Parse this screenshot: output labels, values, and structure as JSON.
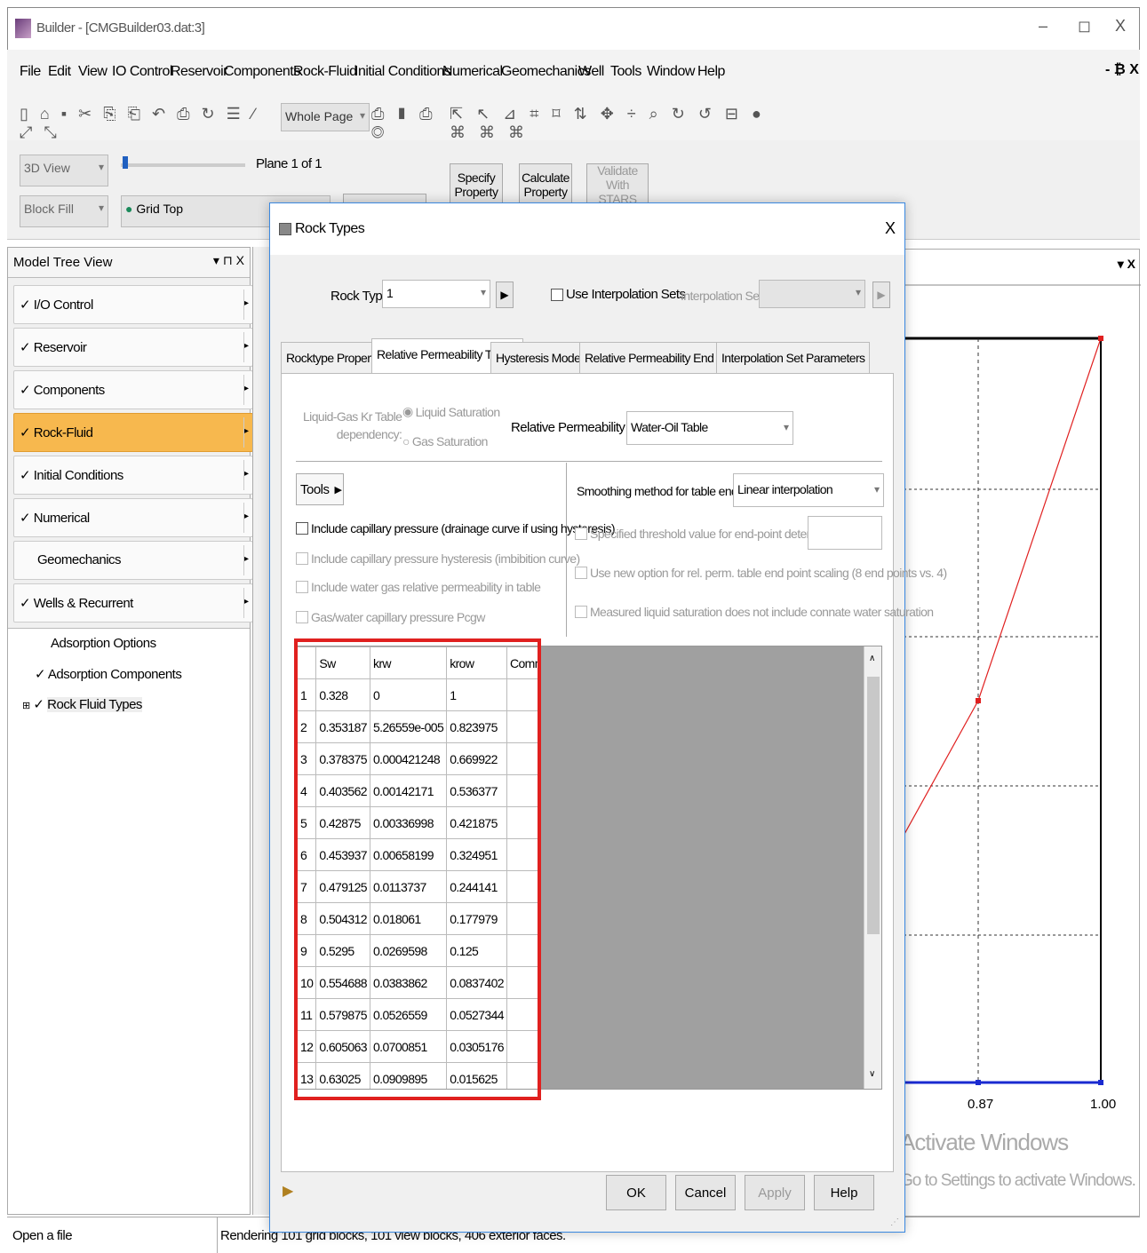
{
  "window": {
    "title": "Builder - [CMGBuilder03.dat:3]",
    "controls": {
      "minimize": "–",
      "restore": "◻",
      "close": "X"
    },
    "mdi_controls": "- ₿ X"
  },
  "menu": [
    "File",
    "Edit",
    "View",
    "IO Control",
    "Reservoir",
    "Components",
    "Rock-Fluid",
    "Initial Conditions",
    "Numerical",
    "Geomechanics",
    "Well",
    "Tools",
    "Window",
    "Help"
  ],
  "toolbar": {
    "page_combo": "Whole Page"
  },
  "ribbon": {
    "view_combo": "3D View",
    "fill_combo": "Block Fill",
    "grid_combo": "Grid Top",
    "plane_label": "Plane 1 of 1",
    "specify_property": "Specify Property",
    "calculate_property": "Calculate Property",
    "validate_stars": "Validate With STARS"
  },
  "tree": {
    "header": "Model Tree View",
    "header_icons": "▾ ⊓ X",
    "sections": [
      {
        "label": "I/O Control",
        "check": "✓"
      },
      {
        "label": "Reservoir",
        "check": "✓"
      },
      {
        "label": "Components",
        "check": "✓"
      },
      {
        "label": "Rock-Fluid",
        "check": "✓"
      },
      {
        "label": "Initial Conditions",
        "check": "✓"
      },
      {
        "label": "Numerical",
        "check": "✓"
      },
      {
        "label": "Geomechanics",
        "check": ""
      },
      {
        "label": "Wells & Recurrent",
        "check": "✓"
      }
    ],
    "items": [
      "Adsorption Options",
      "Adsorption Components",
      "Rock Fluid Types"
    ]
  },
  "plot": {
    "panel_close": "▾ X",
    "x_ticks": [
      "0.87",
      "1.00"
    ],
    "watermark_line1": "Activate Windows",
    "watermark_line2": "Go to Settings to activate Windows."
  },
  "dialog": {
    "title": "Rock Types",
    "close": "X",
    "rock_type_label": "Rock Type",
    "rock_type_value": "1",
    "use_interp_label": "Use Interpolation Sets",
    "interp_sets_label": "Interpolation Sets",
    "tabs": [
      "Rocktype Properties",
      "Relative Permeability Tables",
      "Hysteresis Modelling",
      "Relative Permeability End Points",
      "Interpolation Set Parameters"
    ],
    "lg_dep_label1": "Liquid-Gas Kr Table",
    "lg_dep_label2": "dependency:",
    "radio_liquid": "Liquid Saturation",
    "radio_gas": "Gas Saturation",
    "rpt_label": "Relative Permeability Table:",
    "rpt_value": "Water-Oil Table",
    "tools_btn": "Tools",
    "smoothing_label": "Smoothing method for table end-points:",
    "smoothing_value": "Linear interpolation",
    "checks_left": [
      "Include capillary pressure (drainage curve if using hysteresis)",
      "Include capillary pressure hysteresis (imbibition curve)",
      "Include water gas relative permeability in table",
      "Gas/water capillary pressure Pcgw"
    ],
    "checks_right": [
      "Specified threshold value for end-point determination:",
      "Use new option for rel. perm. table end point scaling (8 end points vs. 4)",
      "Measured liquid saturation does not include connate water saturation"
    ],
    "table_headers": [
      "Sw",
      "krw",
      "krow",
      "Comment"
    ],
    "table_rows": [
      [
        "1",
        "0.328",
        "0",
        "1"
      ],
      [
        "2",
        "0.353187",
        "5.26559e-005",
        "0.823975"
      ],
      [
        "3",
        "0.378375",
        "0.000421248",
        "0.669922"
      ],
      [
        "4",
        "0.403562",
        "0.00142171",
        "0.536377"
      ],
      [
        "5",
        "0.42875",
        "0.00336998",
        "0.421875"
      ],
      [
        "6",
        "0.453937",
        "0.00658199",
        "0.324951"
      ],
      [
        "7",
        "0.479125",
        "0.0113737",
        "0.244141"
      ],
      [
        "8",
        "0.504312",
        "0.018061",
        "0.177979"
      ],
      [
        "9",
        "0.5295",
        "0.0269598",
        "0.125"
      ],
      [
        "10",
        "0.554688",
        "0.0383862",
        "0.0837402"
      ],
      [
        "11",
        "0.579875",
        "0.0526559",
        "0.0527344"
      ],
      [
        "12",
        "0.605063",
        "0.0700851",
        "0.0305176"
      ],
      [
        "13",
        "0.63025",
        "0.0909895",
        "0.015625"
      ]
    ],
    "ok": "OK",
    "cancel": "Cancel",
    "apply": "Apply",
    "help": "Help"
  },
  "status": {
    "left": "Open a file",
    "right": "Rendering 101 grid blocks, 101 view blocks, 406 exterior faces."
  },
  "colors": {
    "accent": "#f7b84e",
    "highlight": "#e0201f",
    "dialog_border": "#3a88e0"
  }
}
